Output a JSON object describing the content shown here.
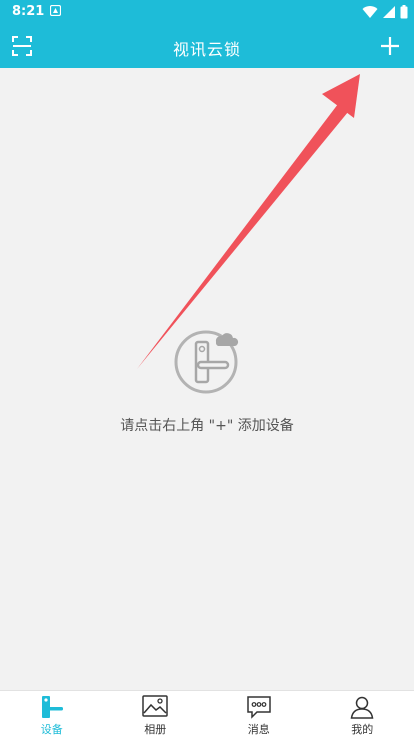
{
  "status_bar": {
    "time": "8:21"
  },
  "app_bar": {
    "title": "视讯云锁"
  },
  "empty_state": {
    "hint": "请点击右上角 \"+\" 添加设备"
  },
  "tabs": [
    {
      "label": "设备",
      "icon": "lock-device-icon",
      "active": true
    },
    {
      "label": "相册",
      "icon": "album-icon",
      "active": false
    },
    {
      "label": "消息",
      "icon": "message-icon",
      "active": false
    },
    {
      "label": "我的",
      "icon": "profile-icon",
      "active": false
    }
  ],
  "colors": {
    "accent": "#1ebcd8",
    "background": "#f2f2f2",
    "annotation_arrow": "#f0525a"
  }
}
